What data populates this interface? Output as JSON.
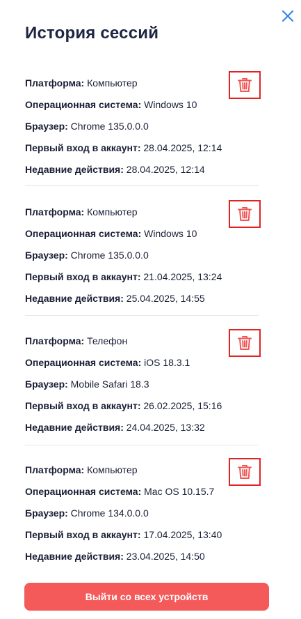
{
  "dialog": {
    "title": "История сессий",
    "close_icon": "close-icon"
  },
  "labels": {
    "platform": "Платформа:",
    "os": "Операционная система:",
    "browser": "Браузер:",
    "first_login": "Первый вход в аккаунт:",
    "recent_activity": "Недавние действия:"
  },
  "sessions": [
    {
      "platform": "Компьютер",
      "os": "Windows 10",
      "browser": "Chrome 135.0.0.0",
      "first_login": "28.04.2025, 12:14",
      "recent_activity": "28.04.2025, 12:14"
    },
    {
      "platform": "Компьютер",
      "os": "Windows 10",
      "browser": "Chrome 135.0.0.0",
      "first_login": "21.04.2025, 13:24",
      "recent_activity": "25.04.2025, 14:55"
    },
    {
      "platform": "Телефон",
      "os": "iOS 18.3.1",
      "browser": "Mobile Safari 18.3",
      "first_login": "26.02.2025, 15:16",
      "recent_activity": "24.04.2025, 13:32"
    },
    {
      "platform": "Компьютер",
      "os": "Mac OS 10.15.7",
      "browser": "Chrome 134.0.0.0",
      "first_login": "17.04.2025, 13:40",
      "recent_activity": "23.04.2025, 14:50"
    }
  ],
  "actions": {
    "logout_all": "Выйти со всех устройств"
  },
  "colors": {
    "accent_blue": "#2f80ed",
    "delete_red": "#f05656",
    "delete_border": "#e02424",
    "logout_button": "#f55a5a",
    "title": "#1c2541"
  },
  "icons": {
    "delete": "trash-icon",
    "close": "close-icon"
  }
}
